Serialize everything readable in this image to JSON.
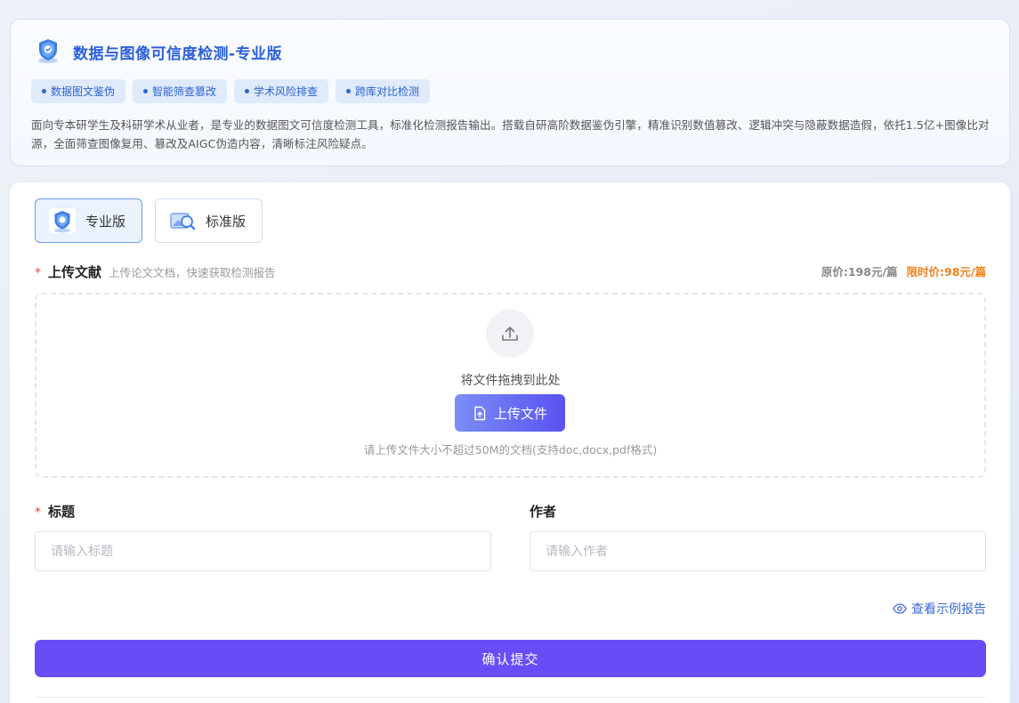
{
  "header": {
    "title": "数据与图像可信度检测-专业版",
    "tags": [
      "数据图文鉴伪",
      "智能筛查篡改",
      "学术风险排查",
      "跨库对比检测"
    ],
    "description": "面向专本研学生及科研学术从业者，是专业的数据图文可信度检测工具，标准化检测报告输出。搭载自研高阶数据鉴伪引擎，精准识别数值篡改、逻辑冲突与隐蔽数据造假，依托1.5亿+图像比对源，全面筛查图像复用、篡改及AIGC伪造内容，清晰标注风险疑点。"
  },
  "versions": {
    "professional": "专业版",
    "standard": "标准版",
    "selected": "专业版"
  },
  "upload": {
    "required_mark": "*",
    "label": "上传文献",
    "sublabel": "上传论文文档，快速获取检测报告",
    "original_price": "原价:198元/篇",
    "sale_price": "限时价:98元/篇",
    "drop_text": "将文件拖拽到此处",
    "button_label": "上传文件",
    "hint": "请上传文件大小不超过50M的文档(支持doc,docx,pdf格式)"
  },
  "form": {
    "title_required_mark": "*",
    "title_label": "标题",
    "title_placeholder": "请输入标题",
    "title_value": "",
    "author_label": "作者",
    "author_placeholder": "请输入作者",
    "author_value": ""
  },
  "actions": {
    "example_report": "查看示例报告",
    "submit": "确认提交"
  },
  "colors": {
    "brand_blue": "#2b5fd9",
    "tag_bg": "#dfeafb",
    "sale_orange": "#f0811a",
    "submit_purple": "#6a4cf6",
    "required_red": "#e54444"
  },
  "icons": {
    "header_logo": "shield-check-icon",
    "professional": "shield-check-icon",
    "standard": "image-search-icon",
    "drop": "upload-arrow-icon",
    "upload_btn": "file-upload-icon",
    "example": "eye-icon"
  }
}
